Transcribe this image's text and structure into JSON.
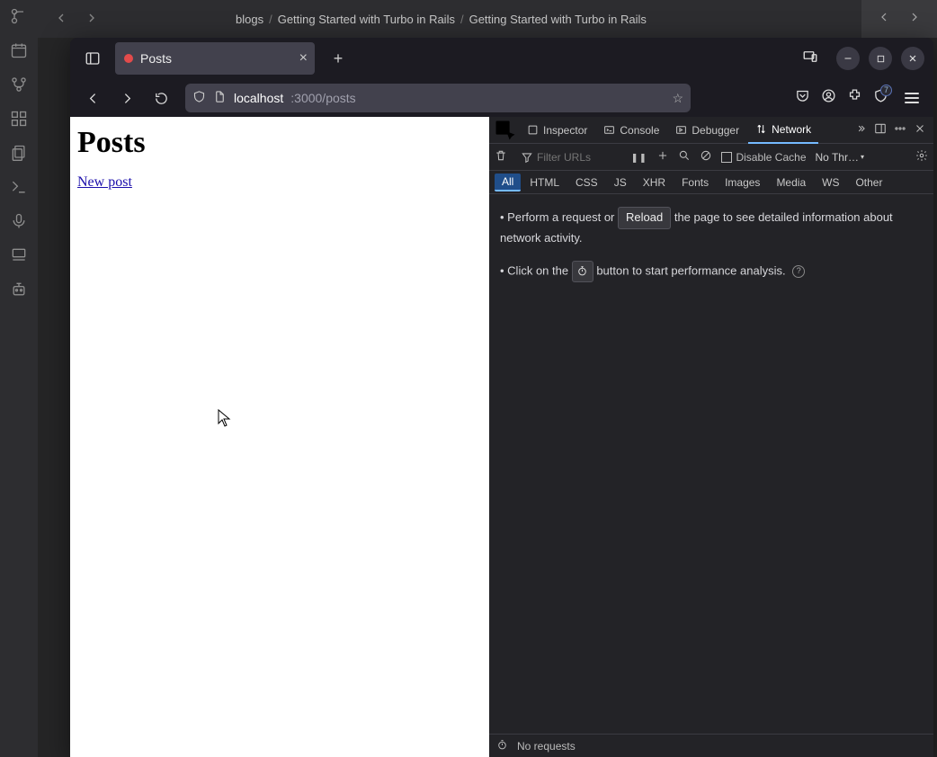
{
  "ide": {
    "breadcrumb": [
      "blogs",
      "Getting Started with Turbo in Rails",
      "Getting Started with Turbo in Rails"
    ]
  },
  "browser": {
    "tab_title": "Posts",
    "address_host": "localhost",
    "address_rest": ":3000/posts",
    "ext_badge": "7"
  },
  "page": {
    "heading": "Posts",
    "new_post_link": "New post"
  },
  "devtools": {
    "tabs": {
      "inspector": "Inspector",
      "console": "Console",
      "debugger": "Debugger",
      "network": "Network"
    },
    "toolbar": {
      "filter_placeholder": "Filter URLs",
      "disable_cache": "Disable Cache",
      "throttle": "No Thr…"
    },
    "filters": [
      "All",
      "HTML",
      "CSS",
      "JS",
      "XHR",
      "Fonts",
      "Images",
      "Media",
      "WS",
      "Other"
    ],
    "hint1_a": "• Perform a request or ",
    "hint1_btn": "Reload",
    "hint1_b": " the page to see detailed information about network activity.",
    "hint2_a": "• Click on the ",
    "hint2_b": " button to start performance analysis.",
    "status": "No requests"
  }
}
